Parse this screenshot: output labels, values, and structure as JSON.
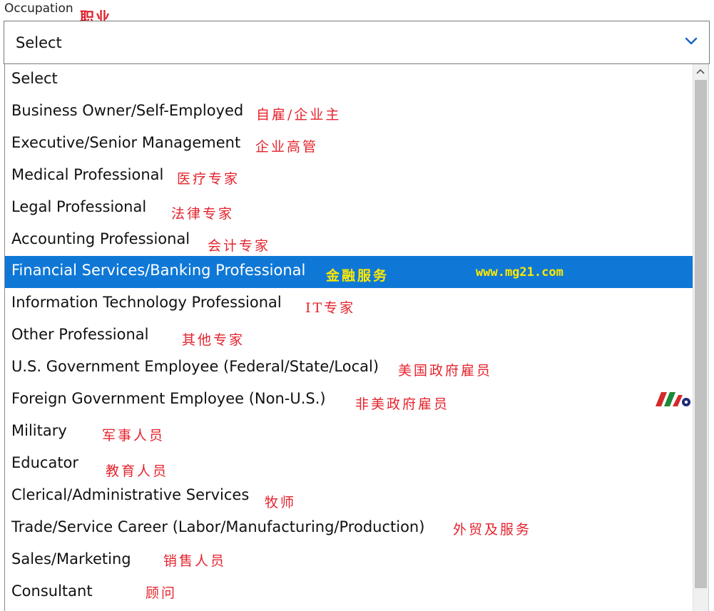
{
  "field": {
    "label": "Occupation",
    "label_cn": "职业",
    "selected_value": "Select",
    "chevron_icon": "chevron-down-icon"
  },
  "dropdown": {
    "options": [
      {
        "label": "Select",
        "cn": ""
      },
      {
        "label": "Business Owner/Self-Employed",
        "cn": "自雇/企业主"
      },
      {
        "label": "Executive/Senior Management",
        "cn": "企业高管"
      },
      {
        "label": "Medical Professional",
        "cn": "医疗专家"
      },
      {
        "label": "Legal Professional",
        "cn": "法律专家"
      },
      {
        "label": "Accounting Professional",
        "cn": "会计专家"
      },
      {
        "label": "Financial Services/Banking Professional",
        "cn": "金融服务",
        "url": "www.mg21.com"
      },
      {
        "label": "Information Technology Professional",
        "cn": "IT专家"
      },
      {
        "label": "Other Professional",
        "cn": "其他专家"
      },
      {
        "label": "U.S. Government Employee (Federal/State/Local)",
        "cn": "美国政府雇员"
      },
      {
        "label": "Foreign Government Employee (Non-U.S.)",
        "cn": "非美政府雇员"
      },
      {
        "label": "Military",
        "cn": "军事人员"
      },
      {
        "label": "Educator",
        "cn": "教育人员"
      },
      {
        "label": "Clerical/Administrative Services",
        "cn": "牧师"
      },
      {
        "label": "Trade/Service Career (Labor/Manufacturing/Production)",
        "cn": "外贸及服务"
      },
      {
        "label": "Sales/Marketing",
        "cn": "销售人员"
      },
      {
        "label": "Consultant",
        "cn": "顾问"
      }
    ],
    "highlighted_index": 6
  },
  "colors": {
    "highlight": "#0f78d6",
    "annotation_red": "#e5232d",
    "annotation_yellow": "#ffe800",
    "chevron": "#1565c0"
  },
  "icons": {
    "scroll_up": "scroll-up-arrow-icon",
    "logo": "mg21-logo-icon"
  }
}
